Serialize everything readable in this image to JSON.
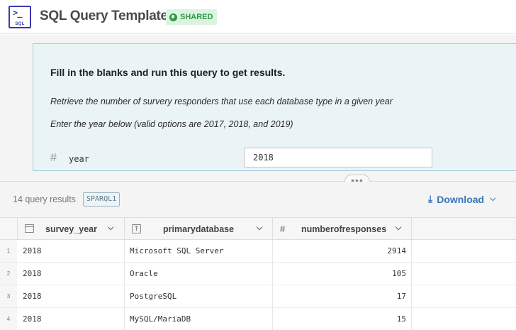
{
  "header": {
    "app_icon_prompt": ">_",
    "app_icon_label": "SQL",
    "title": "SQL Query Template",
    "shared_badge": "SHARED"
  },
  "params": {
    "heading": "Fill in the blanks and run this query to get results.",
    "description_1": "Retrieve the number of survery responders that use each database type in a given year",
    "description_2": "Enter the year below (valid options are 2017, 2018, and 2019)",
    "param_name": "year",
    "param_value": "2018"
  },
  "results": {
    "count_label": "14 query results",
    "query_badge": "SPARQL1",
    "download_label": "Download"
  },
  "table": {
    "columns": [
      {
        "label": "survey_year",
        "type_icon": "calendar-icon"
      },
      {
        "label": "primarydatabase",
        "type_icon": "text-type-icon"
      },
      {
        "label": "numberofresponses",
        "type_icon": "hash-icon"
      }
    ],
    "rows": [
      {
        "num": "1",
        "survey_year": "2018",
        "primarydatabase": "Microsoft SQL Server",
        "numberofresponses": "2914"
      },
      {
        "num": "2",
        "survey_year": "2018",
        "primarydatabase": "Oracle",
        "numberofresponses": "105"
      },
      {
        "num": "3",
        "survey_year": "2018",
        "primarydatabase": "PostgreSQL",
        "numberofresponses": "17"
      },
      {
        "num": "4",
        "survey_year": "2018",
        "primarydatabase": "MySQL/MariaDB",
        "numberofresponses": "15"
      }
    ]
  },
  "colors": {
    "accent_blue": "#3a76b8",
    "shared_green": "#2c9a47",
    "card_bg": "#eaf3f6",
    "card_border": "#a7ccd9"
  }
}
